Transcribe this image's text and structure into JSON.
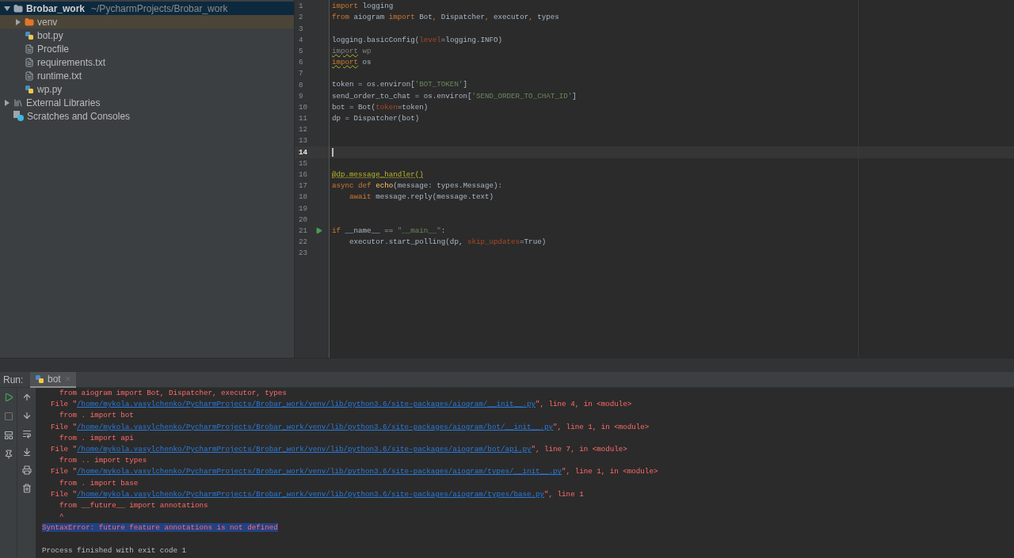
{
  "project_tree": [
    {
      "label": "Brobar_work",
      "path": "~/PycharmProjects/Brobar_work",
      "kind": "project",
      "expanded": true,
      "selected": true,
      "children": [
        {
          "label": "venv",
          "kind": "folder",
          "expanded": false,
          "selected": false,
          "excluded": true
        },
        {
          "label": "bot.py",
          "kind": "python",
          "selected": false,
          "excluded": false
        },
        {
          "label": "Procfile",
          "kind": "text",
          "selected": false,
          "excluded": false
        },
        {
          "label": "requirements.txt",
          "kind": "text",
          "selected": false,
          "excluded": false
        },
        {
          "label": "runtime.txt",
          "kind": "text",
          "selected": false,
          "excluded": false
        },
        {
          "label": "wp.py",
          "kind": "python",
          "selected": false,
          "excluded": false
        }
      ]
    },
    {
      "label": "External Libraries",
      "kind": "libraries",
      "expanded": false,
      "selected": false
    },
    {
      "label": "Scratches and Consoles",
      "kind": "scratches",
      "selected": false
    }
  ],
  "editor": {
    "lines": [
      {
        "number": "1",
        "current": false,
        "run": false,
        "tokens": [
          {
            "kind": "kw",
            "text": "import"
          },
          {
            "kind": "plain",
            "text": " logging"
          }
        ]
      },
      {
        "number": "2",
        "current": false,
        "run": false,
        "tokens": [
          {
            "kind": "kw",
            "text": "from"
          },
          {
            "kind": "plain",
            "text": " aiogram "
          },
          {
            "kind": "kw",
            "text": "import"
          },
          {
            "kind": "plain",
            "text": " Bot"
          },
          {
            "kind": "kw",
            "text": ","
          },
          {
            "kind": "plain",
            "text": " Dispatcher"
          },
          {
            "kind": "kw",
            "text": ","
          },
          {
            "kind": "plain",
            "text": " executor"
          },
          {
            "kind": "kw",
            "text": ","
          },
          {
            "kind": "plain",
            "text": " types"
          }
        ]
      },
      {
        "number": "3",
        "current": false,
        "run": false
      },
      {
        "number": "4",
        "current": false,
        "run": false,
        "tokens": [
          {
            "kind": "plain",
            "text": "logging.basicConfig("
          },
          {
            "kind": "param",
            "text": "level"
          },
          {
            "kind": "plain",
            "text": "=logging.INFO)"
          }
        ]
      },
      {
        "number": "5",
        "current": false,
        "run": false,
        "tokens": [
          {
            "kind": "dim_warn",
            "text": "import"
          },
          {
            "kind": "dim",
            "text": " wp"
          }
        ]
      },
      {
        "number": "6",
        "current": false,
        "run": false,
        "tokens": [
          {
            "kind": "kw_warn",
            "text": "import"
          },
          {
            "kind": "plain",
            "text": " os"
          }
        ]
      },
      {
        "number": "7",
        "current": false,
        "run": false
      },
      {
        "number": "8",
        "current": false,
        "run": false,
        "tokens": [
          {
            "kind": "plain",
            "text": "token = os.environ["
          },
          {
            "kind": "str",
            "text": "'BOT_TOKEN'"
          },
          {
            "kind": "plain",
            "text": "]"
          }
        ]
      },
      {
        "number": "9",
        "current": false,
        "run": false,
        "tokens": [
          {
            "kind": "plain",
            "text": "send_order_to_chat = os.environ["
          },
          {
            "kind": "str",
            "text": "'SEND_ORDER_TO_CHAT_ID'"
          },
          {
            "kind": "plain",
            "text": "]"
          }
        ]
      },
      {
        "number": "10",
        "current": false,
        "run": false,
        "tokens": [
          {
            "kind": "plain",
            "text": "bot = Bot("
          },
          {
            "kind": "param",
            "text": "token"
          },
          {
            "kind": "plain",
            "text": "=token)"
          }
        ]
      },
      {
        "number": "11",
        "current": false,
        "run": false,
        "tokens": [
          {
            "kind": "plain",
            "text": "dp = Dispatcher(bot)"
          }
        ]
      },
      {
        "number": "12",
        "current": false,
        "run": false
      },
      {
        "number": "13",
        "current": false,
        "run": false
      },
      {
        "number": "14",
        "current": true,
        "run": false
      },
      {
        "number": "15",
        "current": false,
        "run": false
      },
      {
        "number": "16",
        "current": false,
        "run": false,
        "tokens": [
          {
            "kind": "deco",
            "text": "@dp.message_handler()"
          }
        ]
      },
      {
        "number": "17",
        "current": false,
        "run": false,
        "tokens": [
          {
            "kind": "kw",
            "text": "async def "
          },
          {
            "kind": "func",
            "text": "echo"
          },
          {
            "kind": "plain",
            "text": "(message: types.Message):"
          }
        ]
      },
      {
        "number": "18",
        "current": false,
        "run": false,
        "tokens": [
          {
            "kind": "kw",
            "text": "    await"
          },
          {
            "kind": "plain",
            "text": " message.reply(message.text)"
          }
        ]
      },
      {
        "number": "19",
        "current": false,
        "run": false
      },
      {
        "number": "20",
        "current": false,
        "run": false
      },
      {
        "number": "21",
        "current": false,
        "run": true,
        "tokens": [
          {
            "kind": "kw",
            "text": "if"
          },
          {
            "kind": "plain",
            "text": " __name__ == "
          },
          {
            "kind": "str",
            "text": "\"__main__\""
          },
          {
            "kind": "plain",
            "text": ":"
          }
        ]
      },
      {
        "number": "22",
        "current": false,
        "run": false,
        "tokens": [
          {
            "kind": "plain",
            "text": "    executor.start_polling(dp, "
          },
          {
            "kind": "param",
            "text": "skip_updates"
          },
          {
            "kind": "plain",
            "text": "=True)"
          }
        ]
      },
      {
        "number": "23",
        "current": false,
        "run": false
      }
    ]
  },
  "run_panel": {
    "label": "Run:",
    "tabs": [
      {
        "label": "bot",
        "selected": true
      }
    ],
    "console": [
      {
        "kind": "error",
        "text": "    from aiogram import Bot, Dispatcher, executor, types"
      },
      {
        "kind": "file",
        "prefix": "  File \"",
        "link": "/home/mykola.vasylchenko/PycharmProjects/Brobar_work/venv/lib/python3.6/site-packages/aiogram/__init__.py",
        "suffix": "\", line 4, in <module>"
      },
      {
        "kind": "error",
        "text": "    from . import bot"
      },
      {
        "kind": "file",
        "prefix": "  File \"",
        "link": "/home/mykola.vasylchenko/PycharmProjects/Brobar_work/venv/lib/python3.6/site-packages/aiogram/bot/__init__.py",
        "suffix": "\", line 1, in <module>"
      },
      {
        "kind": "error",
        "text": "    from . import api"
      },
      {
        "kind": "file",
        "prefix": "  File \"",
        "link": "/home/mykola.vasylchenko/PycharmProjects/Brobar_work/venv/lib/python3.6/site-packages/aiogram/bot/api.py",
        "suffix": "\", line 7, in <module>"
      },
      {
        "kind": "error",
        "text": "    from .. import types"
      },
      {
        "kind": "file",
        "prefix": "  File \"",
        "link": "/home/mykola.vasylchenko/PycharmProjects/Brobar_work/venv/lib/python3.6/site-packages/aiogram/types/__init__.py",
        "suffix": "\", line 1, in <module>"
      },
      {
        "kind": "error",
        "text": "    from . import base"
      },
      {
        "kind": "file",
        "prefix": "  File \"",
        "link": "/home/mykola.vasylchenko/PycharmProjects/Brobar_work/venv/lib/python3.6/site-packages/aiogram/types/base.py",
        "suffix": "\", line 1"
      },
      {
        "kind": "error",
        "text": "    from __future__ import annotations"
      },
      {
        "kind": "error",
        "text": "    ^"
      },
      {
        "kind": "error_selected",
        "text": "SyntaxError: future feature annotations is not defined"
      },
      {
        "kind": "info",
        "text": "Process finished with exit code 1"
      }
    ]
  }
}
